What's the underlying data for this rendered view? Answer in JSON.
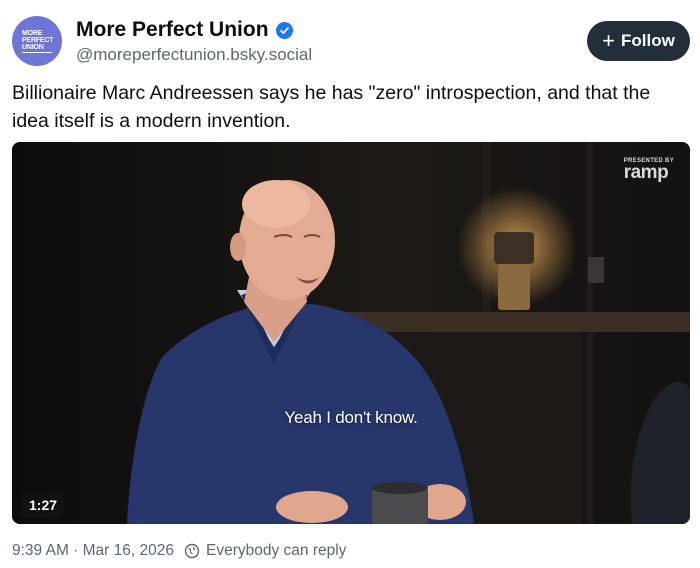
{
  "author": {
    "avatar_text": [
      "MORE",
      "PERFECT",
      "UNION"
    ],
    "display_name": "More Perfect Union",
    "handle": "@moreperfectunion.bsky.social",
    "verified": true
  },
  "follow_button": {
    "label": "Follow",
    "icon": "plus-icon"
  },
  "post": {
    "text": "Billionaire Marc Andreessen says he has \"zero\" introspection, and that the idea itself is a modern invention."
  },
  "video": {
    "brand_small": "PRESENTED BY",
    "brand_name": "ramp",
    "caption": "Yeah I don't know.",
    "duration": "1:27"
  },
  "footer": {
    "timestamp": "9:39 AM · Mar 16, 2026",
    "reply_setting": "Everybody can reply",
    "reply_icon": "globe-icon"
  },
  "colors": {
    "follow_bg": "#232e3a",
    "verified": "#1d77f2",
    "muted": "#5b6876"
  }
}
